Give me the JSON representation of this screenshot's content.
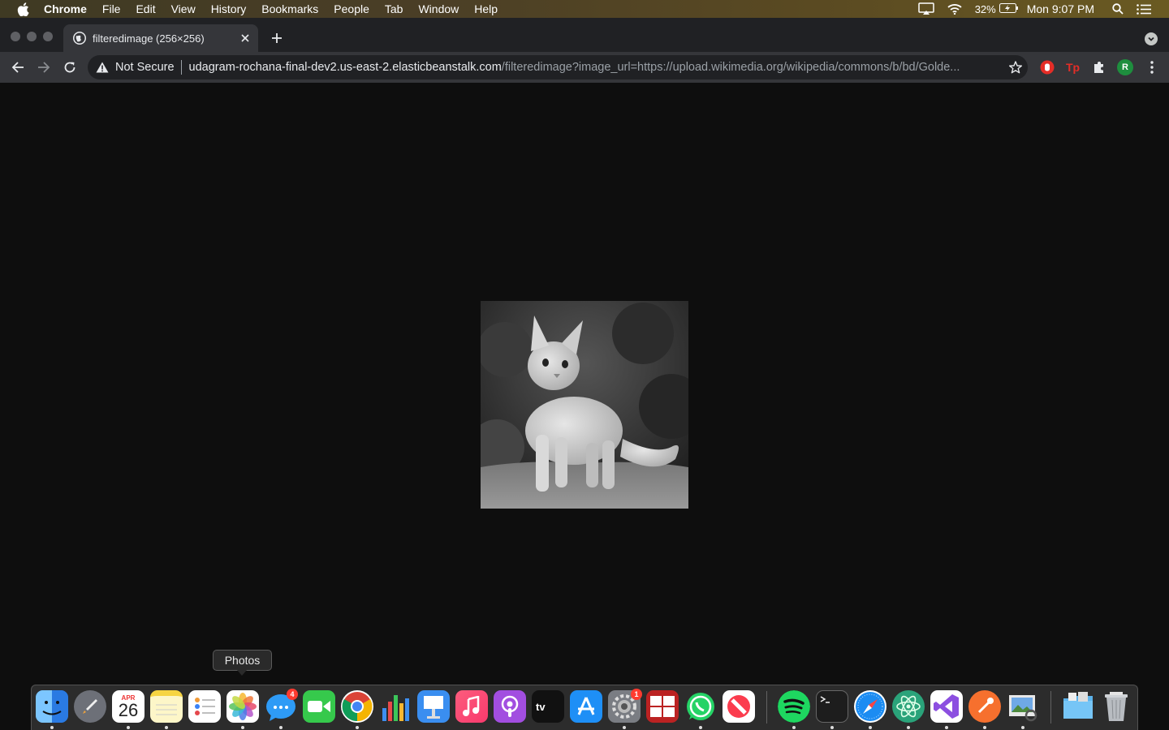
{
  "menubar": {
    "app_name": "Chrome",
    "items": [
      "File",
      "Edit",
      "View",
      "History",
      "Bookmarks",
      "People",
      "Tab",
      "Window",
      "Help"
    ],
    "battery": "32%",
    "clock": "Mon 9:07 PM"
  },
  "browser": {
    "tab_title": "filteredimage (256×256)",
    "security_label": "Not Secure",
    "url_host": "udagram-rochana-final-dev2.us-east-2.elasticbeanstalk.com",
    "url_path": "/filteredimage?image_url=https://upload.wikimedia.org/wikipedia/commons/b/bd/Golde...",
    "profile_initial": "R",
    "extensions": [
      "stop-extension-icon",
      "tp-extension-icon",
      "puzzle-icon"
    ]
  },
  "page": {
    "image_description": "grayscale cat image 256x256"
  },
  "dock": {
    "tooltip": "Photos",
    "calendar_month": "APR",
    "calendar_day": "26",
    "messages_badge": "4",
    "prefs_badge": "1",
    "apps": [
      "Finder",
      "Launchpad",
      "Calendar",
      "Notes",
      "Reminders",
      "Photos",
      "Messages",
      "FaceTime",
      "Chrome",
      "Numbers",
      "Keynote",
      "Music",
      "Podcasts",
      "TV",
      "App Store",
      "System Preferences",
      "Photo Booth",
      "WhatsApp",
      "News",
      "Spotify",
      "Terminal",
      "Safari",
      "Atom",
      "Visual Studio",
      "Postman",
      "Preview",
      "Downloads",
      "Trash"
    ]
  },
  "colors": {
    "page_background": "#0e0e0e",
    "toolbar": "#35363a",
    "tabstrip": "#202124",
    "profile": "#1e8e3e"
  }
}
